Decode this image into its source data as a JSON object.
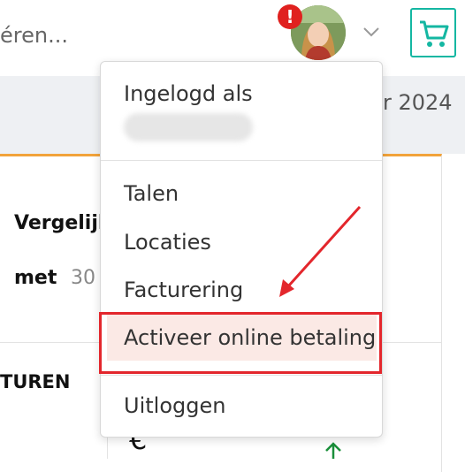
{
  "header": {
    "search_text": "éren...",
    "alert_badge": "!",
    "avatar_alt": "avatar",
    "cart_icon": "cart-icon",
    "chevron_icon": "chevron-down-icon"
  },
  "band": {
    "date_text": "r 2024"
  },
  "card": {
    "label_1": "Vergelijk",
    "label_2": "met",
    "number": "30",
    "section_title": "TUREN",
    "currency": "€"
  },
  "dropdown": {
    "logged_in_label": "Ingelogd als",
    "items": [
      {
        "label": "Talen"
      },
      {
        "label": "Locaties"
      },
      {
        "label": "Facturering"
      },
      {
        "label": "Activeer online betaling"
      },
      {
        "label": "Uitloggen"
      }
    ]
  },
  "colors": {
    "accent_teal": "#14b7a2",
    "alert_red": "#e0211f",
    "annotation_red": "#e3262c",
    "card_top_orange": "#f2a33a"
  }
}
